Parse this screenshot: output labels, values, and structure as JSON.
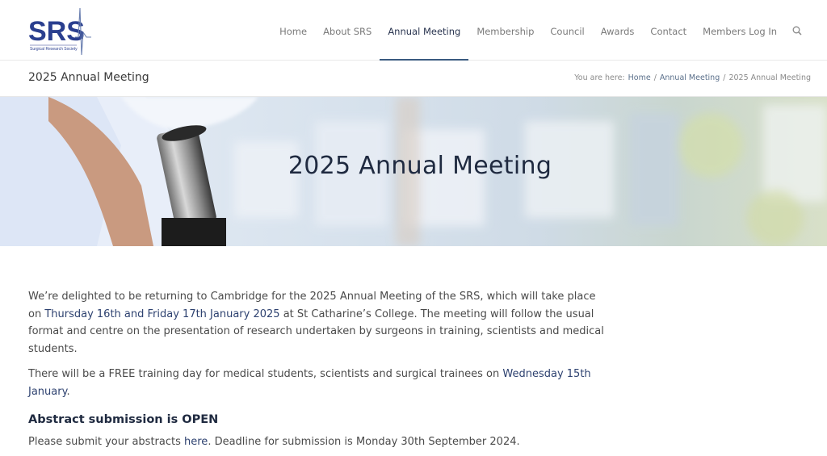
{
  "logo": {
    "text": "SRS",
    "subtitle": "Surgical Research Society"
  },
  "nav": {
    "items": [
      {
        "label": "Home"
      },
      {
        "label": "About SRS"
      },
      {
        "label": "Annual Meeting"
      },
      {
        "label": "Membership"
      },
      {
        "label": "Council"
      },
      {
        "label": "Awards"
      },
      {
        "label": "Contact"
      },
      {
        "label": "Members Log In"
      }
    ],
    "active_index": 2,
    "search_icon": "search-icon"
  },
  "titlebar": {
    "title": "2025 Annual Meeting",
    "breadcrumb_prefix": "You are here:",
    "crumbs": [
      "Home",
      "Annual Meeting",
      "2025 Annual Meeting"
    ],
    "separator": "/"
  },
  "hero": {
    "title": "2025 Annual Meeting"
  },
  "content": {
    "p1_a": "We’re delighted to be returning to Cambridge for the 2025 Annual Meeting of the SRS, which will take place on ",
    "p1_highlight": "Thursday 16th and Friday 17th January 2025",
    "p1_b": " at St Catharine’s College. The meeting will follow the usual format and centre on the presentation of research undertaken by surgeons in training, scientists and medical students.",
    "p2_a": "There will be a FREE training day for medical students, scientists and surgical trainees on ",
    "p2_highlight": "Wednesday 15th January",
    "p2_b": ".",
    "subheading": "Abstract submission is OPEN",
    "p3_a": "Please submit your abstracts ",
    "p3_link": "here",
    "p3_b": ". Deadline for submission is Monday 30th September 2024."
  },
  "colors": {
    "accent": "#2e4270",
    "logo": "#2a3f8f"
  }
}
